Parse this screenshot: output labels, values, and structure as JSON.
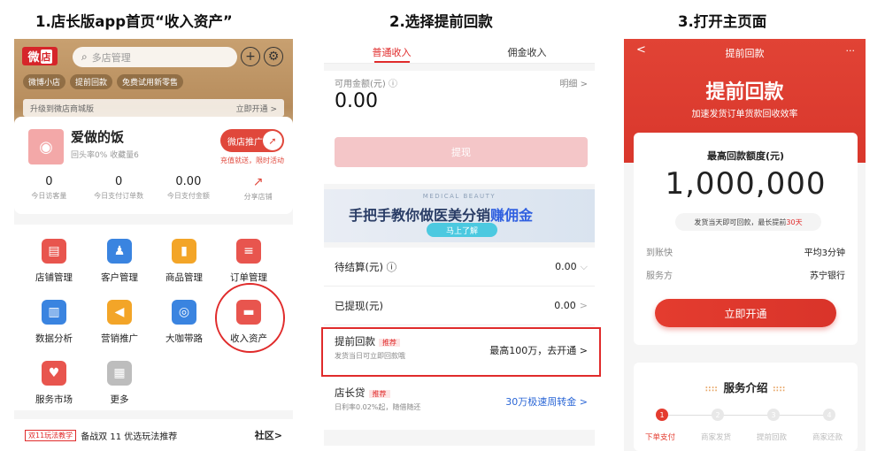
{
  "titles": {
    "t1": "1.店长版app首页“收入资产”",
    "t2": "2.选择提前回款",
    "t3": "3.打开主页面"
  },
  "panel1": {
    "logo_a": "微",
    "logo_b": "店",
    "search_placeholder": "多店管理",
    "chips": [
      "微博小店",
      "提前回款",
      "免费试用新零售"
    ],
    "upgrade_text": "升级到微店商城版",
    "upgrade_action": "立即开通 >",
    "shop_name": "爱做的饭",
    "shop_sub": "回头率0%  收藏量6",
    "promo_label": "微店推广",
    "promo_sub": "充值就送，限时活动",
    "stats": [
      {
        "value": "0",
        "label": "今日访客量"
      },
      {
        "value": "0",
        "label": "今日支付订单数"
      },
      {
        "value": "0.00",
        "label": "今日支付金额"
      },
      {
        "value": "↗",
        "label": "分享店铺"
      }
    ],
    "grid": [
      {
        "label": "店铺管理",
        "icon": "store-icon",
        "glyph": "▤",
        "color": "#e8554e"
      },
      {
        "label": "客户管理",
        "icon": "customer-icon",
        "glyph": "♟",
        "color": "#3a84e0"
      },
      {
        "label": "商品管理",
        "icon": "goods-icon",
        "glyph": "▮",
        "color": "#f3a528"
      },
      {
        "label": "订单管理",
        "icon": "order-icon",
        "glyph": "≡",
        "color": "#e8554e"
      },
      {
        "label": "数据分析",
        "icon": "chart-icon",
        "glyph": "▥",
        "color": "#3a84e0"
      },
      {
        "label": "营销推广",
        "icon": "megaphone-icon",
        "glyph": "◀",
        "color": "#f3a528"
      },
      {
        "label": "大咖带路",
        "icon": "guide-icon",
        "glyph": "◎",
        "color": "#3a84e0"
      },
      {
        "label": "收入资产",
        "icon": "wallet-icon",
        "glyph": "▬",
        "color": "#e8554e"
      },
      {
        "label": "服务市场",
        "icon": "heart-icon",
        "glyph": "♥",
        "color": "#e8554e"
      },
      {
        "label": "更多",
        "icon": "more-icon",
        "glyph": "▦",
        "color": "#bdbdbd"
      }
    ],
    "bottom_tag": "双11玩法教学",
    "bottom_text": "备战双 11 优选玩法推荐",
    "community": "社区>"
  },
  "panel2": {
    "tabs": [
      "普通收入",
      "佣金收入"
    ],
    "avail_label": "可用金额(元) ⓘ",
    "detail": "明细 >",
    "amount": "0.00",
    "withdraw": "提现",
    "banner_top": "MEDICAL BEAUTY",
    "banner_main_a": "手把手教你做医美分销",
    "banner_main_b": "赚佣金",
    "banner_btn": "马上了解",
    "rows": [
      {
        "label": "待结算(元) ⓘ",
        "value": "0.00",
        "chev": "⌵"
      },
      {
        "label": "已提现(元)",
        "value": "0.00",
        "chev": ">"
      }
    ],
    "advance": {
      "title": "提前回款",
      "tag": "推荐",
      "sub": "发货当日可立即回款哦",
      "value": "最高100万，去开通 >"
    },
    "loan": {
      "title": "店长贷",
      "tag": "推荐",
      "sub": "日利率0.02%起，随借随还",
      "value": "30万极速周转金 >"
    }
  },
  "panel3": {
    "nav_back": "<",
    "nav_title": "提前回款",
    "nav_more": "···",
    "headline": "提前回款",
    "subline": "加速发货订单货款回收效率",
    "max_label": "最高回款额度(元)",
    "max_amount": "1,000,000",
    "pill_a": "发货当天即可回款，最长提前",
    "pill_b": "30天",
    "rows": [
      {
        "k": "到账快",
        "v": "平均3分钟"
      },
      {
        "k": "服务方",
        "v": "苏宁银行"
      }
    ],
    "open_button": "立即开通",
    "intro_title": "服务介绍",
    "intro_deco": "∷∷",
    "steps": [
      {
        "num": "1",
        "label": "下单支付"
      },
      {
        "num": "2",
        "label": "商家发货"
      },
      {
        "num": "3",
        "label": "提前回款"
      },
      {
        "num": "4",
        "label": "商家还款"
      }
    ]
  }
}
